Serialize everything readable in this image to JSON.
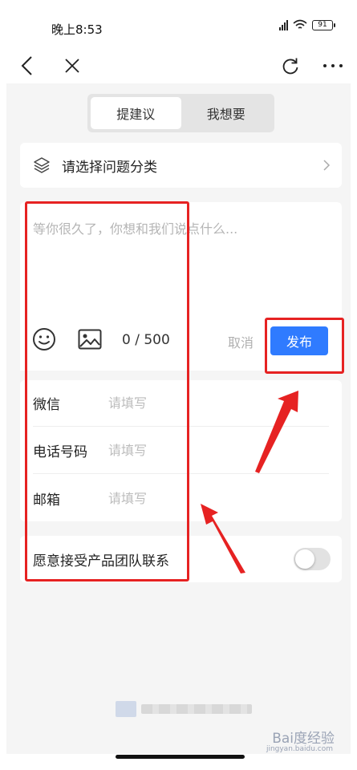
{
  "status_bar": {
    "time": "晚上8:53",
    "battery": "91"
  },
  "nav": {
    "back_icon": "chevron-left-icon",
    "close_icon": "close-icon",
    "refresh_icon": "refresh-icon",
    "more_icon": "more-icon"
  },
  "tabs": [
    {
      "label": "提建议",
      "active": true
    },
    {
      "label": "我想要",
      "active": false
    }
  ],
  "category": {
    "label": "请选择问题分类"
  },
  "composer": {
    "placeholder": "等你很久了，你想和我们说点什么...",
    "counter": "0 / 500",
    "cancel_label": "取消",
    "publish_label": "发布"
  },
  "contacts": [
    {
      "label": "微信",
      "placeholder": "请填写"
    },
    {
      "label": "电话号码",
      "placeholder": "请填写"
    },
    {
      "label": "邮箱",
      "placeholder": "请填写"
    }
  ],
  "consent": {
    "label": "愿意接受产品团队联系",
    "enabled": false
  },
  "watermark": {
    "brand": "Bai度经验",
    "url": "jingyan.baidu.com"
  },
  "colors": {
    "accent": "#2f7bff",
    "annotation": "#e62222",
    "page_bg": "#f5f5f5"
  }
}
